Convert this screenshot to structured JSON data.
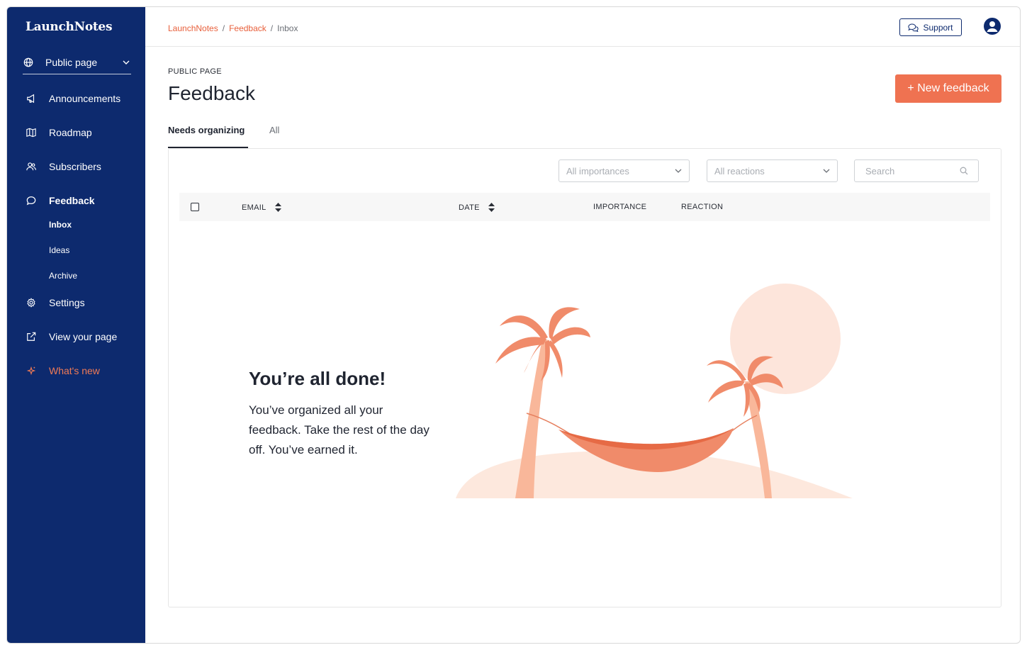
{
  "app": {
    "logo": "LaunchNotes"
  },
  "sidebar": {
    "workspace": "Public page",
    "items": [
      {
        "label": "Announcements",
        "icon": "megaphone-icon"
      },
      {
        "label": "Roadmap",
        "icon": "map-icon"
      },
      {
        "label": "Subscribers",
        "icon": "users-icon"
      },
      {
        "label": "Feedback",
        "icon": "chat-bubble-icon",
        "active": true
      },
      {
        "label": "Settings",
        "icon": "gear-icon"
      },
      {
        "label": "View your page",
        "icon": "external-link-icon"
      },
      {
        "label": "What's new",
        "icon": "sparkle-icon"
      }
    ],
    "feedback_subitems": [
      {
        "label": "Inbox",
        "active": true
      },
      {
        "label": "Ideas"
      },
      {
        "label": "Archive"
      }
    ]
  },
  "topbar": {
    "breadcrumbs": [
      "LaunchNotes",
      "Feedback",
      "Inbox"
    ],
    "separator": "/",
    "support_label": "Support"
  },
  "page": {
    "eyebrow": "PUBLIC PAGE",
    "title": "Feedback",
    "new_button": "+ New feedback",
    "tabs": [
      {
        "label": "Needs organizing",
        "active": true
      },
      {
        "label": "All"
      }
    ]
  },
  "filters": {
    "importance_placeholder": "All importances",
    "reactions_placeholder": "All reactions",
    "search_placeholder": "Search"
  },
  "table": {
    "columns": [
      "EMAIL",
      "DATE",
      "IMPORTANCE",
      "REACTION"
    ]
  },
  "empty_state": {
    "title": "You’re all done!",
    "text": "You’ve organized all your feedback. Take the rest of the day off. You’ve earned it."
  },
  "colors": {
    "sidebar_bg": "#0d2a6e",
    "accent": "#ef7251",
    "link": "#e8603c"
  }
}
